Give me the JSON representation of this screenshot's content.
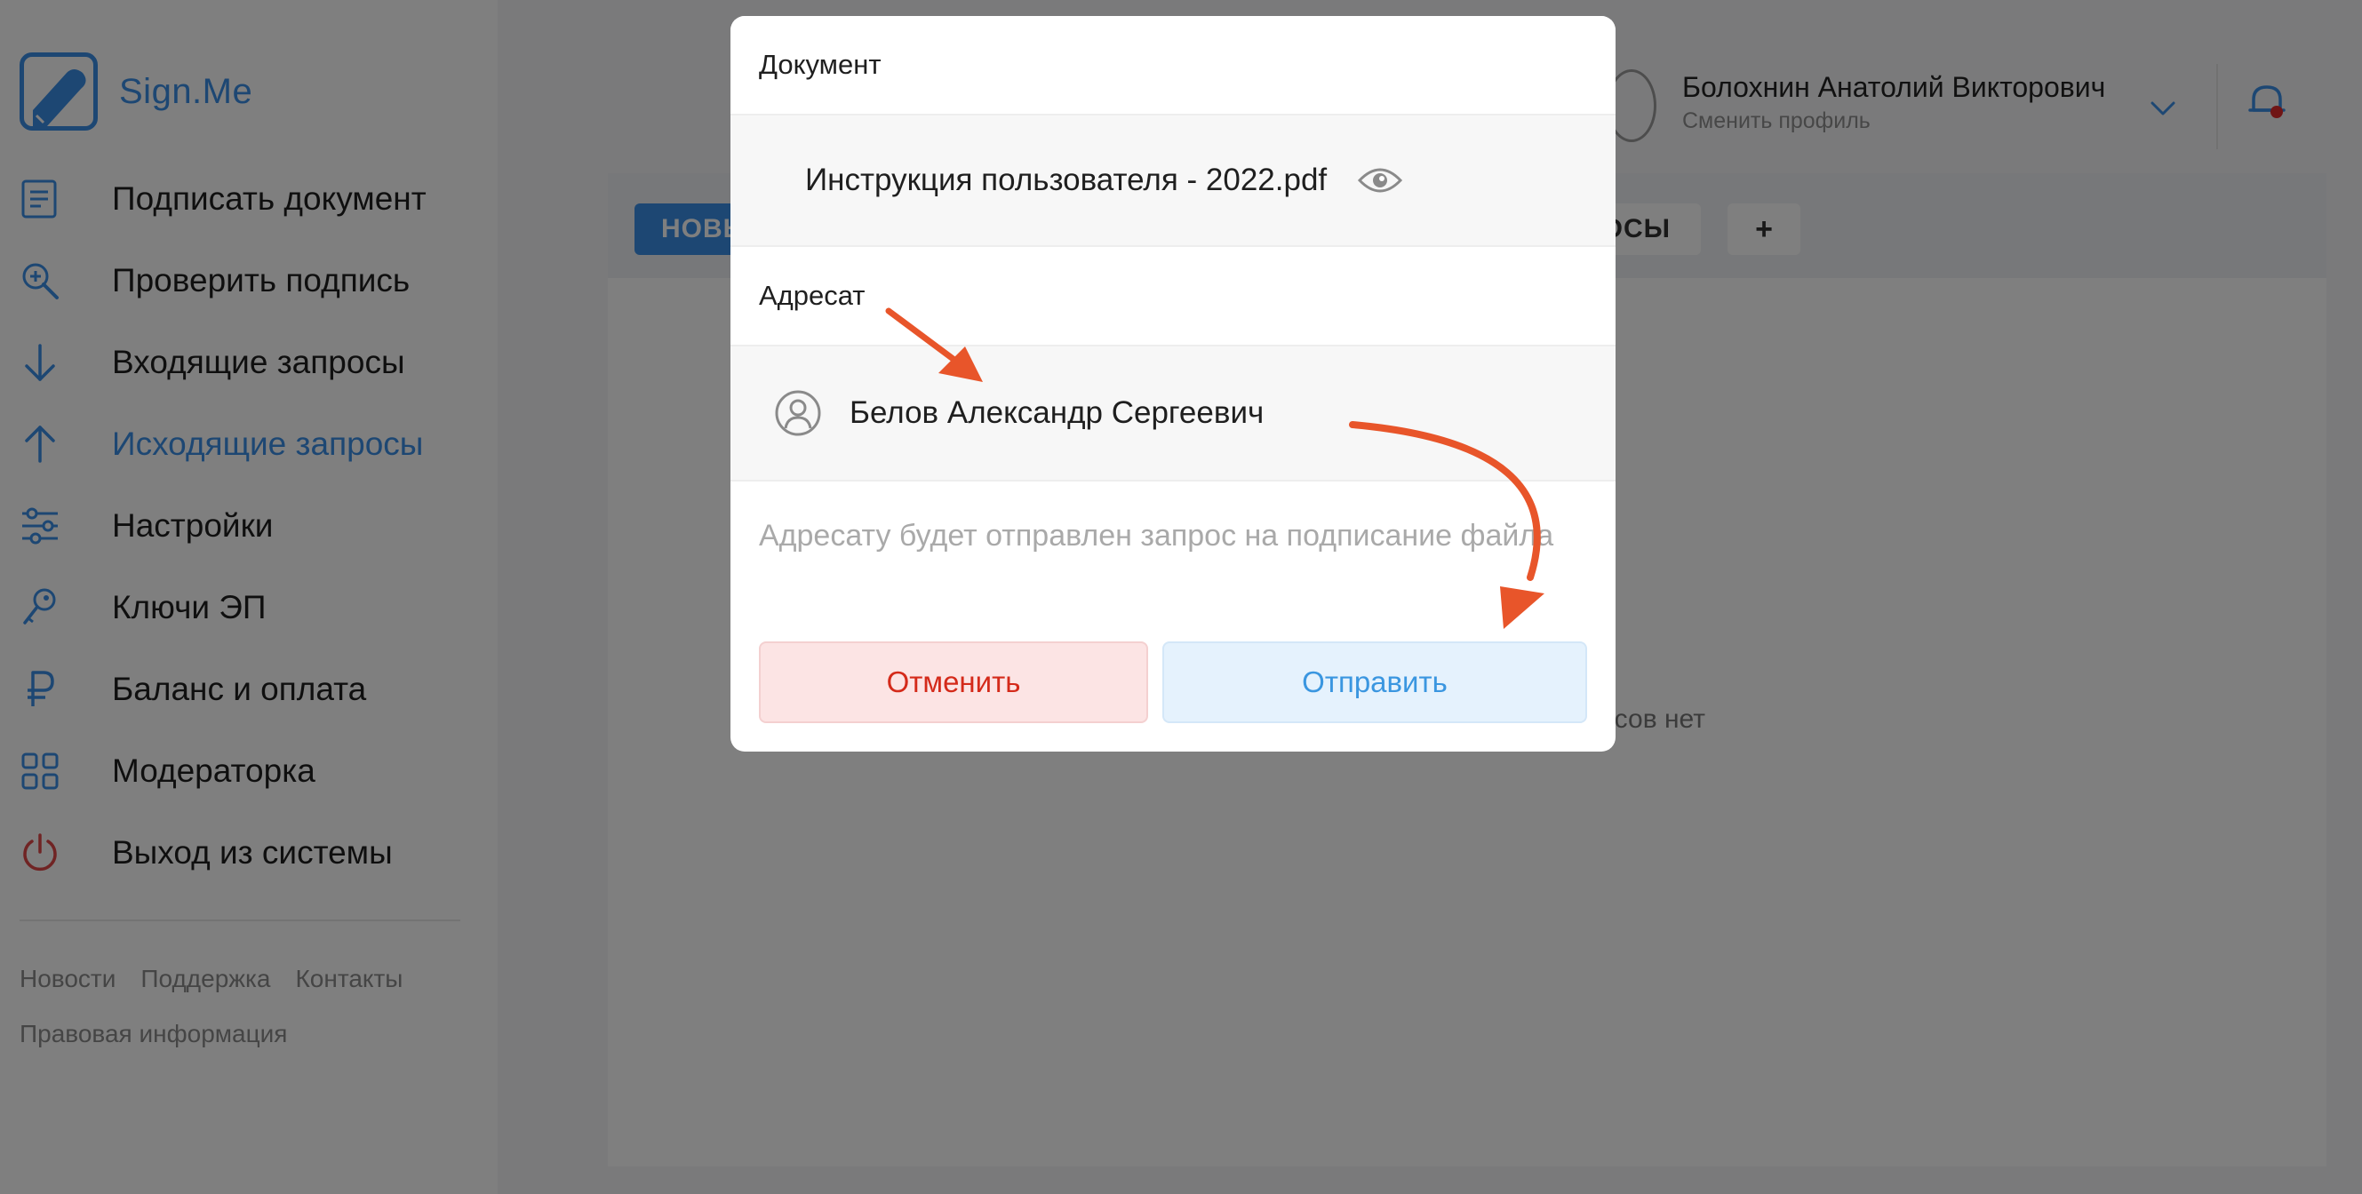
{
  "app": {
    "logo_text": "Sign.Me",
    "accent_color": "#3a8ee6"
  },
  "sidebar": {
    "items": [
      {
        "label": "Подписать документ",
        "icon": "document-icon"
      },
      {
        "label": "Проверить подпись",
        "icon": "search-icon"
      },
      {
        "label": "Входящие запросы",
        "icon": "arrow-down-icon"
      },
      {
        "label": "Исходящие запросы",
        "icon": "arrow-up-icon",
        "active": true
      },
      {
        "label": "Настройки",
        "icon": "sliders-icon"
      },
      {
        "label": "Ключи ЭП",
        "icon": "key-icon"
      },
      {
        "label": "Баланс и оплата",
        "icon": "ruble-icon"
      },
      {
        "label": "Модераторка",
        "icon": "grid-icon"
      },
      {
        "label": "Выход из системы",
        "icon": "power-icon"
      }
    ],
    "footer": {
      "news": "Новости",
      "support": "Поддержка",
      "contacts": "Контакты",
      "legal": "Правовая информация"
    }
  },
  "header": {
    "user_name": "Болохнин Анатолий Викторович",
    "switch_profile": "Сменить профиль"
  },
  "main": {
    "tabs": {
      "new": "НОВЫ",
      "other": "ОСЫ",
      "add": "+"
    },
    "empty_text": "осов нет"
  },
  "modal": {
    "document_heading": "Документ",
    "document_name": "Инструкция пользователя - 2022.pdf",
    "recipient_heading": "Адресат",
    "recipient_name": "Белов Александр Сергеевич",
    "hint": "Адресату будет отправлен запрос на подписание файла",
    "cancel_label": "Отменить",
    "send_label": "Отправить"
  },
  "annotation": {
    "arrow_color": "#e8552a"
  }
}
